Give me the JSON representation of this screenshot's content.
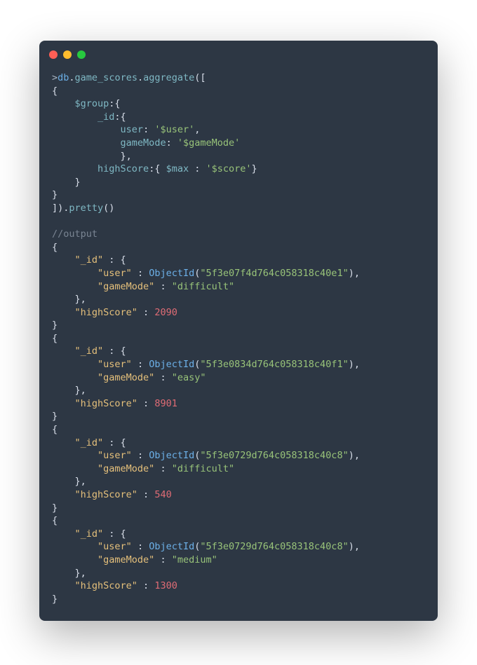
{
  "query": {
    "prompt": ">",
    "db": "db",
    "collection": "game_scores",
    "aggregate": "aggregate",
    "groupOp": "$group",
    "idKey": "_id",
    "userKey": "user",
    "userVal": "'$user'",
    "gameModeKey": "gameMode",
    "gameModeVal": "'$gameMode'",
    "highScoreKey": "highScore",
    "maxOp": "$max",
    "scoreVal": "'$score'",
    "pretty": "pretty"
  },
  "comment": "//output",
  "labels": {
    "id": "\"_id\"",
    "user": "\"user\"",
    "gameMode": "\"gameMode\"",
    "highScore": "\"highScore\"",
    "objectId": "ObjectId"
  },
  "results": [
    {
      "userId": "\"5f3e07f4d764c058318c40e1\"",
      "gameMode": "\"difficult\"",
      "highScore": "2090"
    },
    {
      "userId": "\"5f3e0834d764c058318c40f1\"",
      "gameMode": "\"easy\"",
      "highScore": "8901"
    },
    {
      "userId": "\"5f3e0729d764c058318c40c8\"",
      "gameMode": "\"difficult\"",
      "highScore": "540"
    },
    {
      "userId": "\"5f3e0729d764c058318c40c8\"",
      "gameMode": "\"medium\"",
      "highScore": "1300"
    }
  ]
}
